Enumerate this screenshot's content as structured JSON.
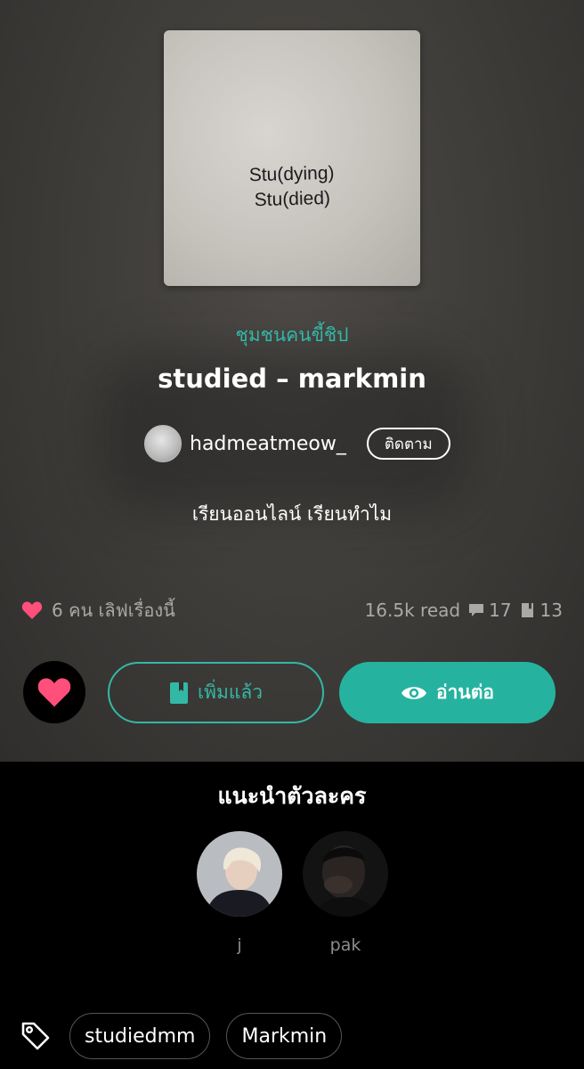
{
  "story": {
    "cover_text": [
      "Stu(dying)",
      "Stu(died)"
    ],
    "category": "ชุมชนคนขี้ชิป",
    "title": "studied – markmin",
    "author": "hadmeatmeow_",
    "follow_label": "ติดตาม",
    "description": "เรียนออนไลน์ เรียนทำไม"
  },
  "stats": {
    "likes_text": "6 คน เลิฟเรื่องนี้",
    "reads": "16.5k read",
    "comments": "17",
    "chapters": "13"
  },
  "actions": {
    "added_label": "เพิ่มแล้ว",
    "read_label": "อ่านต่อ"
  },
  "characters": {
    "title": "แนะนำตัวละคร",
    "items": [
      {
        "name": "j"
      },
      {
        "name": "pak"
      }
    ]
  },
  "tags": [
    "studiedmm",
    "Markmin"
  ],
  "colors": {
    "accent": "#25b3a0",
    "heart": "#ff4f7a"
  }
}
